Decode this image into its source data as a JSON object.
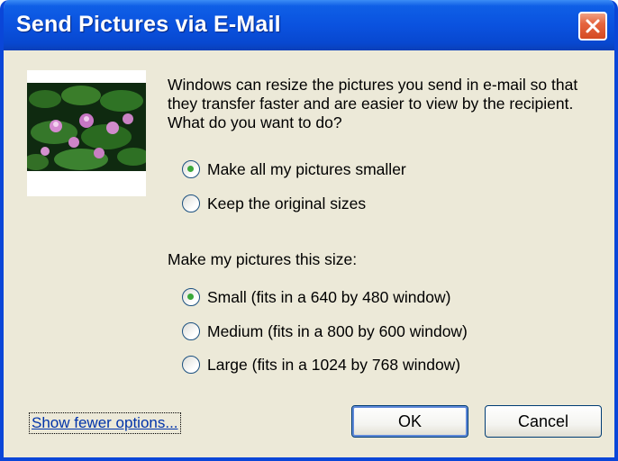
{
  "window": {
    "title": "Send Pictures via E-Mail"
  },
  "description": "Windows can resize the pictures you send in e-mail so that they transfer faster and are easier to view by the recipient.  What do you want to do?",
  "resize_options": [
    {
      "label": "Make all my pictures smaller",
      "checked": true
    },
    {
      "label": "Keep the original sizes",
      "checked": false
    }
  ],
  "size_section_label": "Make my pictures this size:",
  "size_options": [
    {
      "label": "Small (fits in a 640 by 480 window)",
      "checked": true
    },
    {
      "label": "Medium (fits in a 800 by 600 window)",
      "checked": false
    },
    {
      "label": "Large (fits in a 1024 by 768 window)",
      "checked": false
    }
  ],
  "footer": {
    "toggle_link": "Show fewer options...",
    "ok_label": "OK",
    "cancel_label": "Cancel"
  },
  "icons": {
    "close": "close-icon"
  },
  "colors": {
    "titlebar": "#0a52df",
    "dialog_bg": "#ECE9D8",
    "close_button": "#e5653f",
    "radio_dot": "#3aa83a"
  }
}
